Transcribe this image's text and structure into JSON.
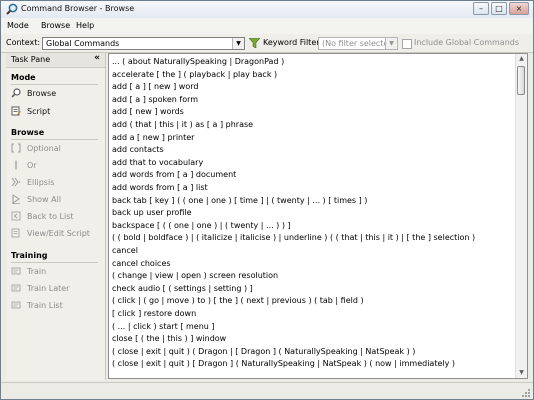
{
  "window": {
    "title": "Command Browser - Browse",
    "icon": "magnifier-icon",
    "controls": [
      "minimize-icon",
      "maximize-icon",
      "close-icon"
    ]
  },
  "menubar": {
    "items": [
      "Mode",
      "Browse",
      "Help"
    ]
  },
  "toolbar": {
    "context_label": "Context:",
    "context_value": "Global Commands",
    "keyword_filter_label": "Keyword Filter",
    "filter_value": "(No filter selected)",
    "include_global_label": "Include Global Commands",
    "include_global_checked": false
  },
  "task_pane": {
    "title": "Task Pane",
    "collapse_glyph": "«",
    "sections": {
      "mode": {
        "title": "Mode",
        "items": [
          {
            "label": "Browse",
            "icon": "magnifier-icon",
            "enabled": true
          },
          {
            "label": "Script",
            "icon": "script-icon",
            "enabled": true
          }
        ]
      },
      "browse": {
        "title": "Browse",
        "items": [
          {
            "label": "Optional",
            "icon": "optional-icon",
            "enabled": false
          },
          {
            "label": "Or",
            "icon": "or-icon",
            "enabled": false
          },
          {
            "label": "Ellipsis",
            "icon": "ellipsis-icon",
            "enabled": false
          },
          {
            "label": "Show All",
            "icon": "show-all-icon",
            "enabled": false
          },
          {
            "label": "Back to List",
            "icon": "back-to-list-icon",
            "enabled": false
          },
          {
            "label": "View/Edit Script",
            "icon": "view-edit-script-icon",
            "enabled": false
          }
        ]
      },
      "training": {
        "title": "Training",
        "items": [
          {
            "label": "Train",
            "icon": "train-icon",
            "enabled": false
          },
          {
            "label": "Train Later",
            "icon": "train-later-icon",
            "enabled": false
          },
          {
            "label": "Train List",
            "icon": "train-list-icon",
            "enabled": false
          }
        ]
      }
    }
  },
  "commands": [
    "... ( about NaturallySpeaking | DragonPad )",
    "accelerate [ the ] ( playback | play back )",
    "add [ a ] [ new ] word",
    "add [ a ] spoken form",
    "add [ new ] words",
    "add ( that | this | it ) as [ a ] phrase",
    "add a [ new ] printer",
    "add contacts",
    "add that to vocabulary",
    "add words from [ a ] document",
    "add words from [ a ] list",
    "back tab [ key ] ( ( one | one ) [ time ] | ( twenty | ... ) [ times ] )",
    "back up user profile",
    "backspace [ ( ( one | one ) | ( twenty | ... ) ) ]",
    "( ( bold | boldface ) | ( italicize | italicise ) | underline ) ( ( that | this | it ) | [ the ] selection )",
    "cancel",
    "cancel choices",
    "( change | view | open ) screen resolution",
    "check audio [ ( settings | setting ) ]",
    "( click | ( go | move ) to ) [ the ] ( next | previous ) ( tab | field )",
    "[ click ] restore down",
    "( ... | click ) start [ menu ]",
    "close [ ( the | this ) ] window",
    "( close | exit | quit ) ( Dragon | [ Dragon ] ( NaturallySpeaking | NatSpeak ) )",
    "( close | exit | quit ) [ Dragon ] ( NaturallySpeaking | NatSpeak ) ( now | immediately )"
  ],
  "colors": {
    "accent": "#6d7e93",
    "disabled_text": "#8d8d8d",
    "window_bg": "#ecebe6"
  }
}
